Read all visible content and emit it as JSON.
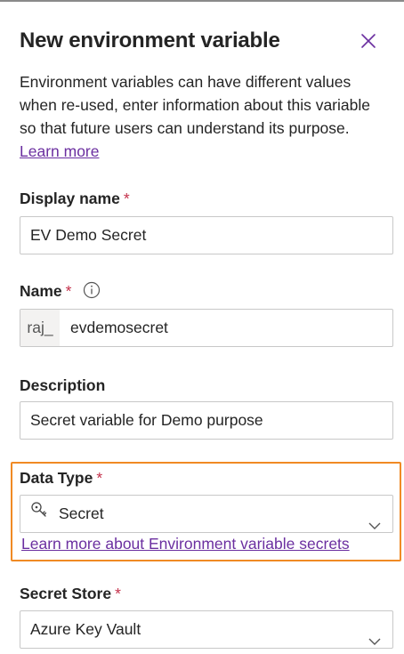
{
  "panel": {
    "title": "New environment variable",
    "intro_text": "Environment variables can have different values when re-used, enter information about this variable so that future users can understand its purpose.",
    "learn_more_label": "Learn more"
  },
  "fields": {
    "display_name": {
      "label": "Display name",
      "required": "*",
      "value": "EV Demo Secret"
    },
    "name": {
      "label": "Name",
      "required": "*",
      "prefix": "raj_",
      "value": "evdemosecret"
    },
    "description": {
      "label": "Description",
      "value": "Secret variable for Demo purpose"
    },
    "data_type": {
      "label": "Data Type",
      "required": "*",
      "value": "Secret",
      "icon": "key-icon"
    },
    "secret_link_label": "Learn more about Environment variable secrets",
    "secret_store": {
      "label": "Secret Store",
      "required": "*",
      "value": "Azure Key Vault"
    }
  },
  "colors": {
    "link": "#6b2fa0",
    "required": "#c4314b",
    "highlight": "#f08a24",
    "border": "#c8c8c8"
  }
}
